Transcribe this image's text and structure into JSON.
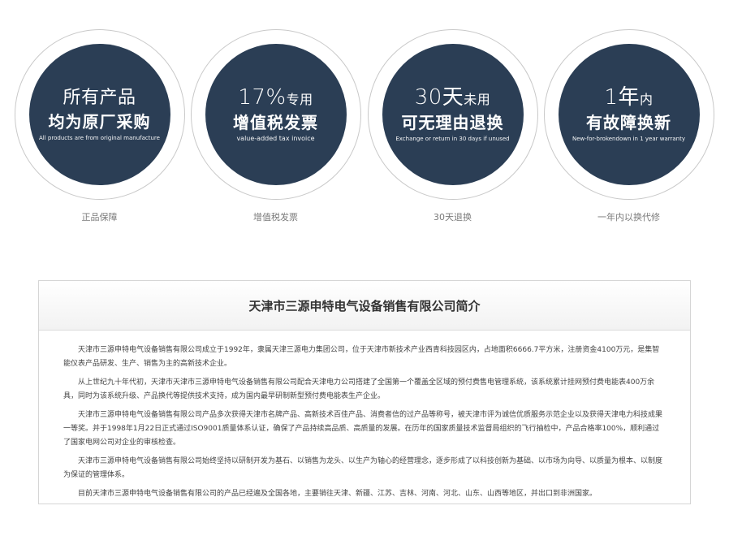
{
  "badges": [
    {
      "line1_main": "所有产品",
      "line1_small": "",
      "line2": "均为原厂采购",
      "line3": "All products are from original manufacture",
      "caption": "正品保障"
    },
    {
      "line1_main": "17%",
      "line1_small": "专用",
      "line2": "增值税发票",
      "line3": "value-added tax invoice",
      "caption": "增值税发票"
    },
    {
      "line1_main": "30天",
      "line1_small": "未用",
      "line2": "可无理由退换",
      "line3": "Exchange or return in 30 days if unused",
      "caption": "30天退换"
    },
    {
      "line1_main": "1年",
      "line1_small": "内",
      "line2": "有故障换新",
      "line3": "New-for-brokendown in 1 year warranty",
      "caption": "一年内以换代修"
    }
  ],
  "intro": {
    "title": "天津市三源申特电气设备销售有限公司简介",
    "paragraphs": [
      "天津市三源申特电气设备销售有限公司成立于1992年，隶属天津三源电力集团公司，位于天津市新技术产业西青科技园区内，占地面积6666.7平方米，注册资金4100万元，是集智能仪表产品研发、生产、销售为主的高新技术企业。",
      "从上世纪九十年代初，天津市天津市三源申特电气设备销售有限公司配合天津电力公司搭建了全国第一个覆盖全区域的预付费售电管理系统，该系统累计挂网预付费电能表400万余具，同时为该系统升级、产品换代等提供技术支持，成为国内最早研制新型预付费电能表生产企业。",
      "天津市三源申特电气设备销售有限公司产品多次获得天津市名牌产品、高新技术百佳产品、消费者信的过产品等称号，被天津市评为诚信优质服务示范企业以及获得天津电力科技成果一等奖。并于1998年1月22日正式通过ISO9001质量体系认证，确保了产品持续高品质、高质量的发展。在历年的国家质量技术监督局组织的飞行抽检中，产品合格率100%，顺利通过了国家电网公司对企业的审核检查。",
      "天津市三源申特电气设备销售有限公司始终坚持以研制开发为基石、以销售为龙头、以生产为轴心的经营理念，逐步形成了以科技创新为基础、以市场为向导、以质量为根本、以制度为保证的管理体系。",
      "目前天津市三源申特电气设备销售有限公司的产品已经遍及全国各地，主要销往天津、新疆、江苏、吉林、河南、河北、山东、山西等地区，并出口到非洲国家。"
    ]
  },
  "colors": {
    "disc": "#2b3e55",
    "ring_border": "#c9c9c9",
    "caption": "#7a7a7a"
  }
}
